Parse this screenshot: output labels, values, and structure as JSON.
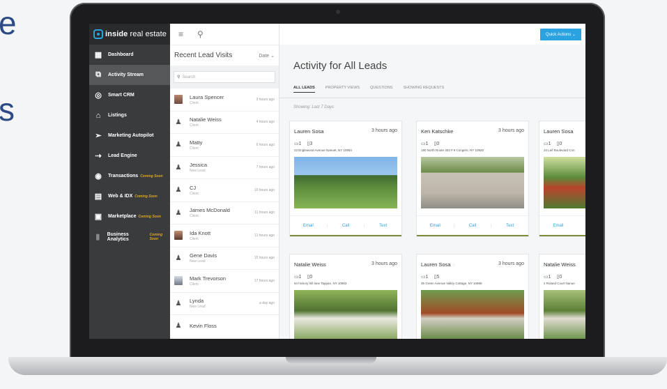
{
  "background": {
    "text_top": "e",
    "text_mid": "s"
  },
  "sidebar": {
    "brand": {
      "bold": "inside",
      "light": "real estate"
    },
    "items": [
      {
        "label": "Dashboard",
        "soon": ""
      },
      {
        "label": "Activity Stream",
        "soon": ""
      },
      {
        "label": "Smart CRM",
        "soon": ""
      },
      {
        "label": "Listings",
        "soon": ""
      },
      {
        "label": "Marketing Autopilot",
        "soon": ""
      },
      {
        "label": "Lead Engine",
        "soon": ""
      },
      {
        "label": "Transactions",
        "soon": "Coming Soon"
      },
      {
        "label": "Web & IDX",
        "soon": "Coming Soon"
      },
      {
        "label": "Marketplace",
        "soon": "Coming Soon"
      },
      {
        "label": "Business Analytics",
        "soon": "Coming Soon"
      }
    ]
  },
  "topbar": {
    "menu_icon": "≡",
    "search_icon": "⚲",
    "quick_actions": "Quick Actions ⌄"
  },
  "leads": {
    "title": "Recent Lead Visits",
    "sort": "Date",
    "search_placeholder": "Search",
    "items": [
      {
        "name": "Laura Spencer",
        "type": "Client",
        "time": "3 hours ago"
      },
      {
        "name": "Natalie Weiss",
        "type": "Client",
        "time": "4 hours ago"
      },
      {
        "name": "Matty",
        "type": "Client",
        "time": "6 hours ago"
      },
      {
        "name": "Jessica",
        "type": "New Lead",
        "time": "7 hours ago"
      },
      {
        "name": "CJ",
        "type": "Client",
        "time": "10 hours ago"
      },
      {
        "name": "James McDonald",
        "type": "Client",
        "time": "11 hours ago"
      },
      {
        "name": "Ida Knott",
        "type": "Client",
        "time": "11 hours ago"
      },
      {
        "name": "Gene Davis",
        "type": "New Lead",
        "time": "15 hours ago"
      },
      {
        "name": "Mark Trevorson",
        "type": "Client",
        "time": "17 hours ago"
      },
      {
        "name": "Lynda",
        "type": "New Lead",
        "time": "a day ago"
      },
      {
        "name": "Kevin Floss",
        "type": "",
        "time": ""
      }
    ]
  },
  "main": {
    "title": "Activity for All Leads",
    "tabs": [
      "ALL LEADS",
      "PROPERTY VIEWS",
      "QUESTIONS",
      "SHOWING REQUESTS"
    ],
    "showing": "Showing: Last 7 Days",
    "cards": [
      {
        "name": "Lauren Sosa",
        "time": "3 hours ago",
        "views": "1",
        "phone": "3",
        "address": "23 Englewood Avenue Nanuet, NY 10954",
        "email": "Email",
        "call": "Call",
        "text": "Text"
      },
      {
        "name": "Ken Katschke",
        "time": "3 hours ago",
        "views": "1",
        "phone": "0",
        "address": "180 North Route 303 # 6 Congers, NY 10920",
        "email": "Email",
        "call": "Call",
        "text": "Text"
      },
      {
        "name": "Lauren Sosa",
        "time": "",
        "views": "1",
        "phone": "0",
        "address": "34 Leif Boulevard Con",
        "email": "Email",
        "call": "",
        "text": ""
      },
      {
        "name": "Natalie Weiss",
        "time": "3 hours ago",
        "views": "1",
        "phone": "0",
        "address": "64 hickory hill lane Tappan, NY 10983"
      },
      {
        "name": "Lauren Sosa",
        "time": "3 hours ago",
        "views": "1",
        "phone": "5",
        "address": "35 Green Avenue Valley Cottage, NY 10989"
      },
      {
        "name": "Natalie Weiss",
        "time": "",
        "views": "1",
        "phone": "0",
        "address": "2 Roland Court Nanue"
      }
    ]
  }
}
